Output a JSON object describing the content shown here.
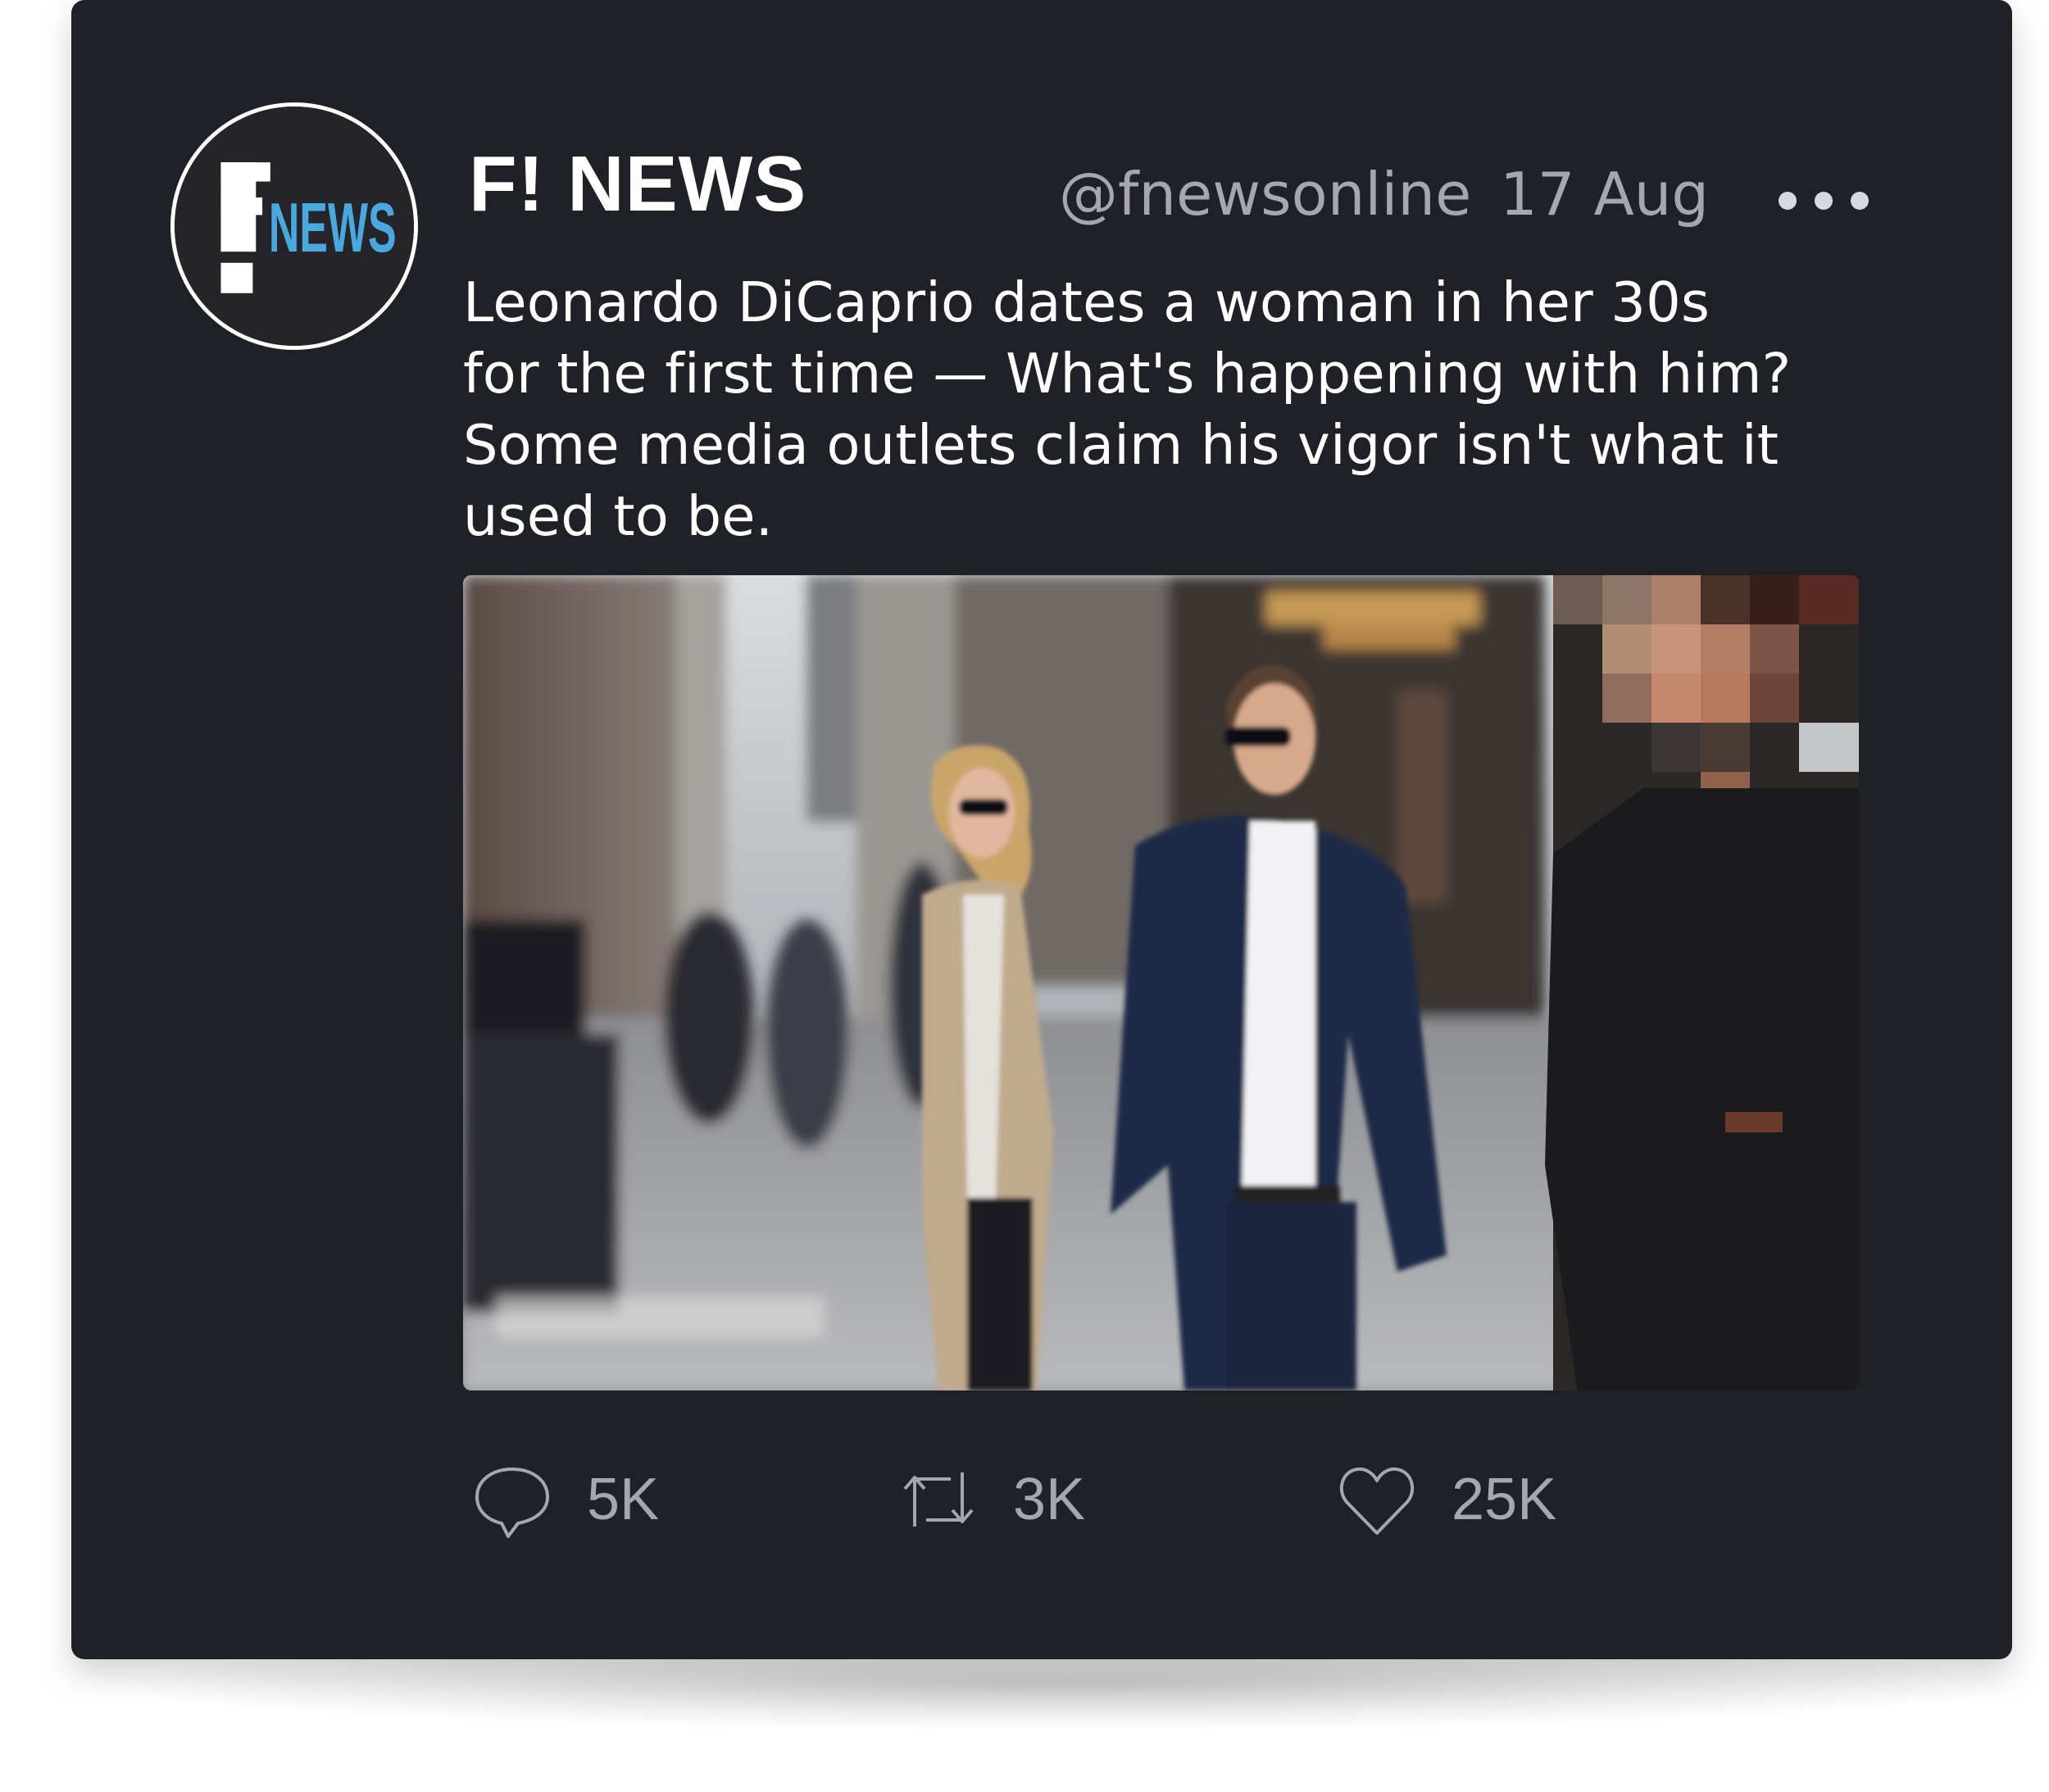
{
  "author": {
    "name": "F! NEWS",
    "handle": "@fnewsonline",
    "date": "17 Aug",
    "avatar_logo": {
      "mark": "F!",
      "word": "NEWS",
      "word_color": "#4aa8e0"
    }
  },
  "tweet": {
    "text_lines": [
      "Leonardo DiCaprio dates a woman in her 30s",
      "for the first time — What's happening with him?",
      "Some media outlets claim his vigor isn't what it",
      "used to be."
    ]
  },
  "menu": {
    "icon": "more-dots-icon"
  },
  "actions": {
    "reply": {
      "icon": "reply-bubble-icon",
      "count": "5K"
    },
    "retweet": {
      "icon": "retweet-icon",
      "count": "3K"
    },
    "like": {
      "icon": "heart-icon",
      "count": "25K"
    }
  },
  "colors": {
    "card_background": "#202126",
    "text_primary": "#ffffff",
    "text_secondary": "#a5a6ae"
  }
}
